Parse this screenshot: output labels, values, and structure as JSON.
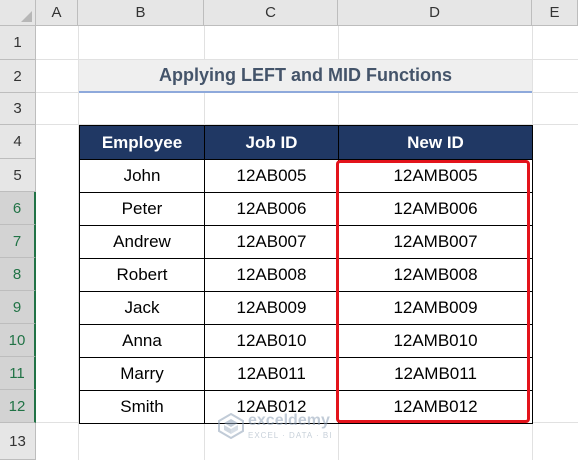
{
  "columns": [
    "A",
    "B",
    "C",
    "D",
    "E"
  ],
  "rows": [
    "1",
    "2",
    "3",
    "4",
    "5",
    "6",
    "7",
    "8",
    "9",
    "10",
    "11",
    "12",
    "13"
  ],
  "title": "Applying LEFT and MID Functions",
  "table": {
    "headers": [
      "Employee",
      "Job ID",
      "New ID"
    ],
    "rows": [
      [
        "John",
        "12AB005",
        "12AMB005"
      ],
      [
        "Peter",
        "12AB006",
        "12AMB006"
      ],
      [
        "Andrew",
        "12AB007",
        "12AMB007"
      ],
      [
        "Robert",
        "12AB008",
        "12AMB008"
      ],
      [
        "Jack",
        "12AB009",
        "12AMB009"
      ],
      [
        "Anna",
        "12AB010",
        "12AMB010"
      ],
      [
        "Marry",
        "12AB011",
        "12AMB011"
      ],
      [
        "Smith",
        "12AB012",
        "12AMB012"
      ]
    ]
  },
  "watermark": {
    "name": "exceldemy",
    "tagline": "EXCEL · DATA · BI"
  },
  "colors": {
    "header_bg": "#203864",
    "highlight": "#e3131b",
    "title_text": "#44546a"
  }
}
